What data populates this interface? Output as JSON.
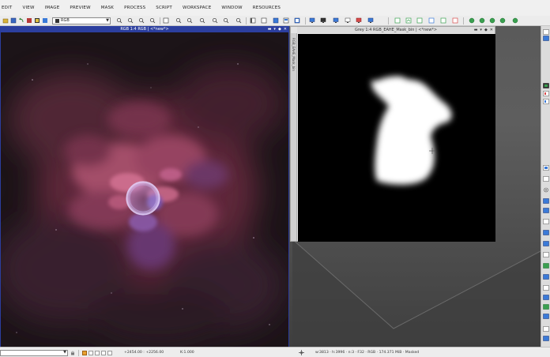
{
  "menu": [
    "EDIT",
    "VIEW",
    "IMAGE",
    "PREVIEW",
    "MASK",
    "PROCESS",
    "SCRIPT",
    "WORKSPACE",
    "WINDOW",
    "RESOURCES"
  ],
  "toolbar": {
    "view_selector": "RGB",
    "icons": [
      "open-file-icon",
      "save-icon",
      "undo-icon",
      "redo-icon",
      "zoom-in-icon",
      "zoom-out-icon",
      "zoom-fit-icon",
      "pan-icon",
      "readout-icon",
      "preview-icon",
      "mask-icon",
      "stf-icon",
      "screen-icon",
      "process-icon",
      "script-icon",
      "console-icon",
      "explorer-icon",
      "history-icon"
    ]
  },
  "windows": {
    "rgb": {
      "title": "RGB 1:4 RGB | <*new*>",
      "controls": [
        "minimize-icon",
        "shade-icon",
        "maximize-icon",
        "close-icon"
      ]
    },
    "grey": {
      "title": "Grey 1:4 RGB_EAHE_Mask_bin | <*new*>",
      "tab_label": "RGB_EAHE_Mask_bin",
      "controls": [
        "minimize-icon",
        "shade-icon",
        "maximize-icon",
        "close-icon"
      ]
    }
  },
  "statusbar": {
    "coords": "+2454.00 : +2256.00",
    "zoom_readout": "K:1.000",
    "info": "w:3813 · h:3996 · n:3 · F32 · RGB · 174.371 MiB · Masked"
  },
  "colors": {
    "accent": "#2c3f9f",
    "nebula_pink": "#c06078",
    "nebula_purple": "#7a5ab8",
    "mask_white": "#ffffff",
    "workspace": "#555555"
  }
}
